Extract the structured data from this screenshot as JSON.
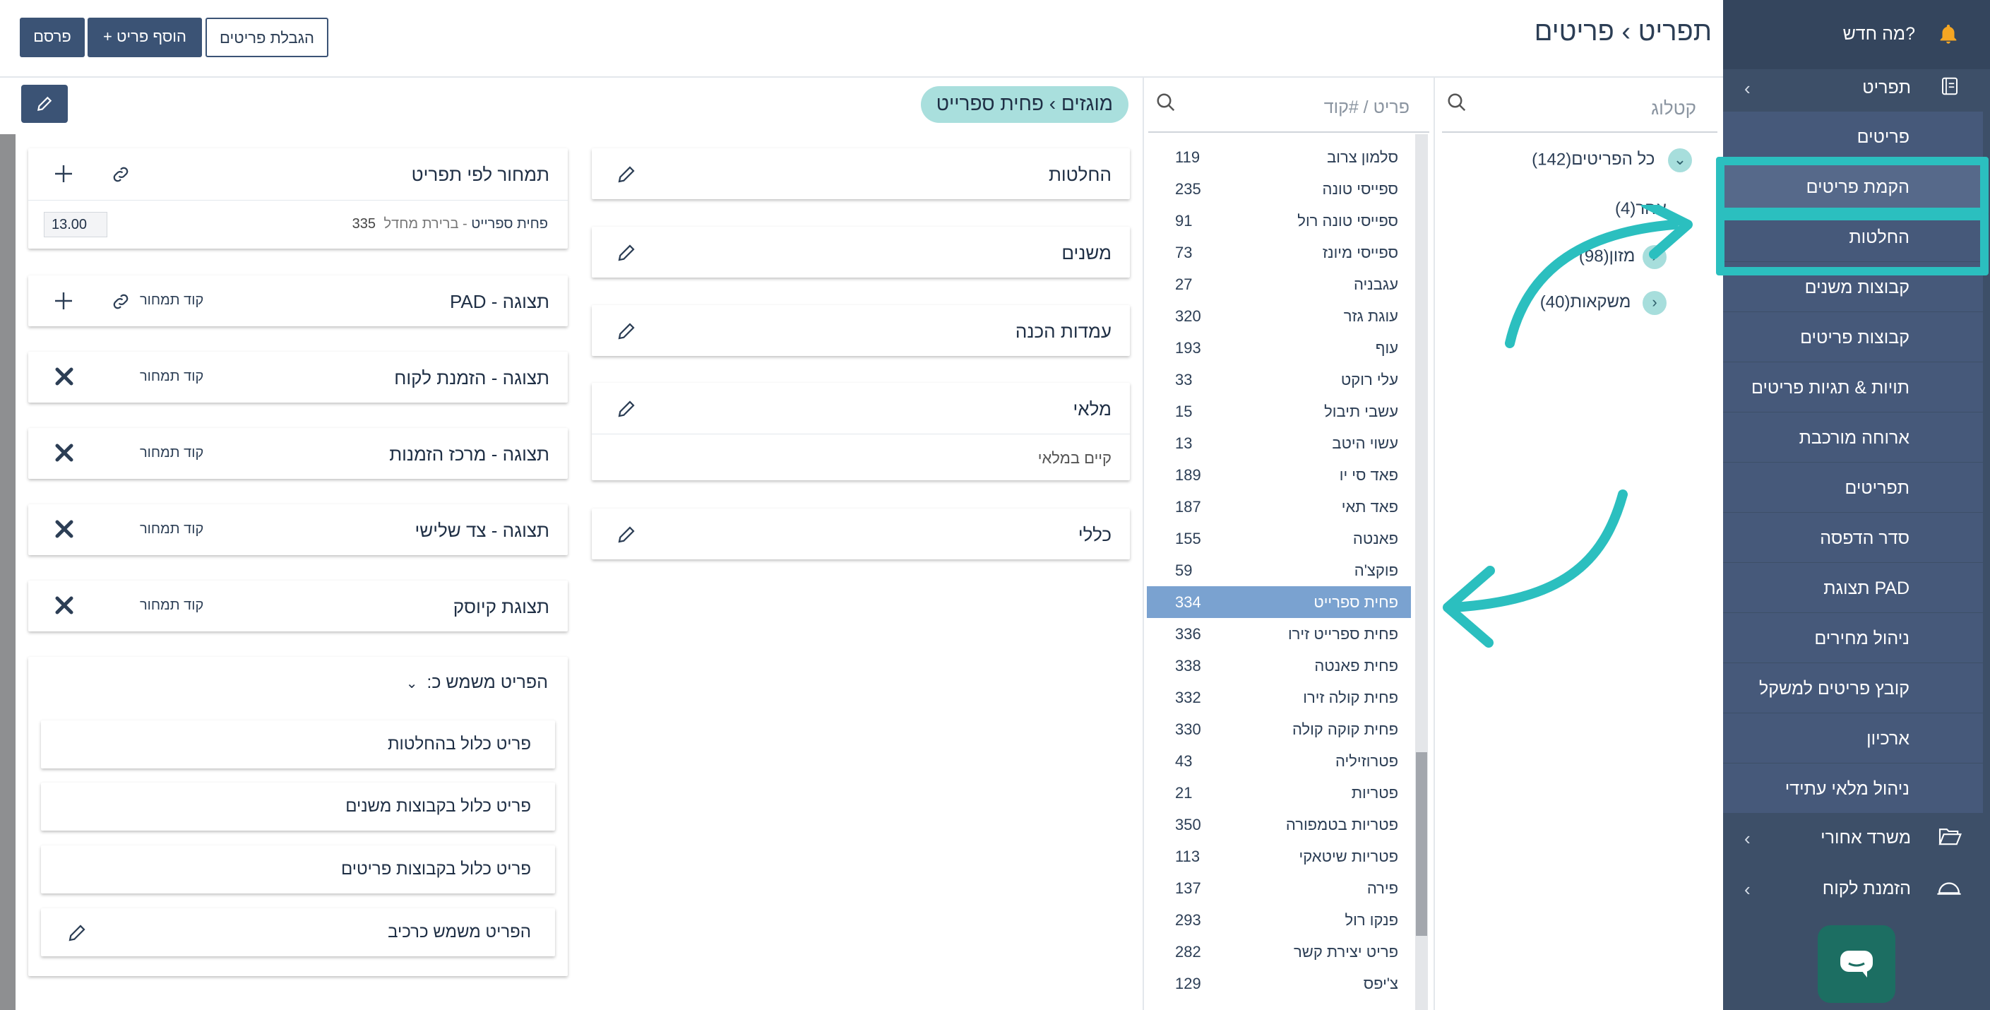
{
  "header": {
    "breadcrumb_root": "תפריט",
    "breadcrumb_current": "פריטים",
    "publish_label": "פרסם",
    "add_item_label": "+ הוסף פריט",
    "limit_items_label": "הגבלת פריטים"
  },
  "sidebar": {
    "whats_new": "מה חדש?",
    "menu_section": "תפריט",
    "items": [
      "פריטים",
      "הקמת פריטים",
      "החלטות",
      "קבוצות משנים",
      "קבוצות פריטים",
      "תויות & תגיות פריטים",
      "ארוחה מורכבת",
      "תפריטים",
      "סדר הדפסה",
      "תצוגת PAD",
      "ניהול מחירים",
      "קובץ פריטים למשקל",
      "ארכיון",
      "ניהול מלאי עתידי"
    ],
    "back_office": "משרד אחורי",
    "customer_order": "הזמנת לקוח"
  },
  "catalog": {
    "search_placeholder": "קטלוג",
    "tree": [
      {
        "label": "כל הפריטים",
        "count": "(142)"
      },
      {
        "label": "אחר",
        "count": "(4)"
      },
      {
        "label": "מזון",
        "count": "(98)"
      },
      {
        "label": "משקאות",
        "count": "(40)"
      }
    ]
  },
  "items_list": {
    "search_placeholder": "פריט / #קוד",
    "items": [
      {
        "name": "סלמון צרוב",
        "code": "119"
      },
      {
        "name": "ספייסי טונה",
        "code": "235"
      },
      {
        "name": "ספייסי טונה רול",
        "code": "91"
      },
      {
        "name": "ספייסי מיונז",
        "code": "73"
      },
      {
        "name": "עגבניה",
        "code": "27"
      },
      {
        "name": "עוגת גזר",
        "code": "320"
      },
      {
        "name": "עוף",
        "code": "193"
      },
      {
        "name": "עלי רוקט",
        "code": "33"
      },
      {
        "name": "עשבי תיבול",
        "code": "15"
      },
      {
        "name": "עשוי היטב",
        "code": "13"
      },
      {
        "name": "פאד סי יו",
        "code": "189"
      },
      {
        "name": "פאד תאי",
        "code": "187"
      },
      {
        "name": "פאנטה",
        "code": "155"
      },
      {
        "name": "פוקצ'ה",
        "code": "59"
      },
      {
        "name": "פחית ספרייט",
        "code": "334"
      },
      {
        "name": "פחית ספרייט זירו",
        "code": "336"
      },
      {
        "name": "פחית פאנטה",
        "code": "338"
      },
      {
        "name": "פחית קולה זירו",
        "code": "332"
      },
      {
        "name": "פחית קוקה קולה",
        "code": "330"
      },
      {
        "name": "פטרוזיליה",
        "code": "43"
      },
      {
        "name": "פטריות",
        "code": "21"
      },
      {
        "name": "פטריות בטמפורה",
        "code": "350"
      },
      {
        "name": "פטריות שיטאקי",
        "code": "113"
      },
      {
        "name": "פירה",
        "code": "137"
      },
      {
        "name": "פנקו רול",
        "code": "293"
      },
      {
        "name": "פריט יצירת קשר",
        "code": "282"
      },
      {
        "name": "צ'יפס",
        "code": "129"
      }
    ]
  },
  "detail": {
    "breadcrumb_parent": "מוגזים",
    "breadcrumb_current": "פחית ספרייט",
    "mid_cards": {
      "decisions": "החלטות",
      "modifiers": "משנים",
      "prep_stations": "עמדות הכנה",
      "stock": "מלאי",
      "stock_note": "קיים במלאי",
      "general": "כללי"
    },
    "price_card": {
      "title": "תמחור לפי תפריט",
      "item_name": "פחית ספרייט",
      "menu_name": "- ברירת מחדל",
      "menu_code": "335",
      "price": "13.00"
    },
    "views": [
      {
        "title": "תצוגה - PAD",
        "code_label": "קוד תמחור",
        "action": "add"
      },
      {
        "title": "תצוגה - הזמנת לקוח",
        "code_label": "קוד תמחור",
        "action": "remove"
      },
      {
        "title": "תצוגה - מרכז הזמנות",
        "code_label": "קוד תמחור",
        "action": "remove"
      },
      {
        "title": "תצוגה - צד שלישי",
        "code_label": "קוד תמחור",
        "action": "remove"
      },
      {
        "title": "תצוגת קיוסק",
        "code_label": "קוד תמחור",
        "action": "remove"
      }
    ],
    "used_as": {
      "title": "הפריט משמש כ:",
      "rows": [
        "פריט כלול בהחלטות",
        "פריט כלול בקבוצות משנים",
        "פריט כלול בקבוצות פריטים",
        "הפריט משמש כרכיב"
      ]
    }
  },
  "colors": {
    "sidebar": "#3d4f68",
    "accent": "#2bbfbf",
    "selected_row": "#7aa2d0",
    "primary_button": "#3b5375"
  }
}
